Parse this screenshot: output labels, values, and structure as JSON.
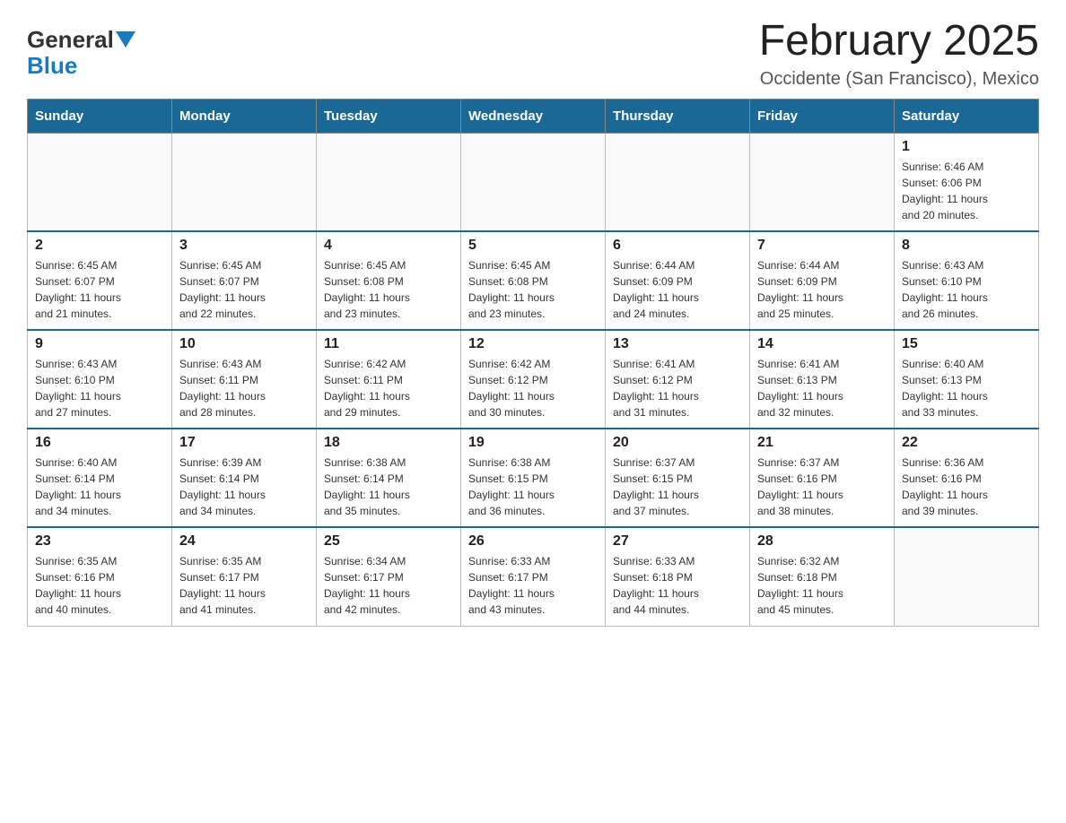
{
  "header": {
    "logo": {
      "general": "General",
      "blue": "Blue"
    },
    "title": "February 2025",
    "location": "Occidente (San Francisco), Mexico"
  },
  "days_of_week": [
    "Sunday",
    "Monday",
    "Tuesday",
    "Wednesday",
    "Thursday",
    "Friday",
    "Saturday"
  ],
  "weeks": [
    {
      "days": [
        {
          "number": "",
          "info": ""
        },
        {
          "number": "",
          "info": ""
        },
        {
          "number": "",
          "info": ""
        },
        {
          "number": "",
          "info": ""
        },
        {
          "number": "",
          "info": ""
        },
        {
          "number": "",
          "info": ""
        },
        {
          "number": "1",
          "info": "Sunrise: 6:46 AM\nSunset: 6:06 PM\nDaylight: 11 hours\nand 20 minutes."
        }
      ]
    },
    {
      "days": [
        {
          "number": "2",
          "info": "Sunrise: 6:45 AM\nSunset: 6:07 PM\nDaylight: 11 hours\nand 21 minutes."
        },
        {
          "number": "3",
          "info": "Sunrise: 6:45 AM\nSunset: 6:07 PM\nDaylight: 11 hours\nand 22 minutes."
        },
        {
          "number": "4",
          "info": "Sunrise: 6:45 AM\nSunset: 6:08 PM\nDaylight: 11 hours\nand 23 minutes."
        },
        {
          "number": "5",
          "info": "Sunrise: 6:45 AM\nSunset: 6:08 PM\nDaylight: 11 hours\nand 23 minutes."
        },
        {
          "number": "6",
          "info": "Sunrise: 6:44 AM\nSunset: 6:09 PM\nDaylight: 11 hours\nand 24 minutes."
        },
        {
          "number": "7",
          "info": "Sunrise: 6:44 AM\nSunset: 6:09 PM\nDaylight: 11 hours\nand 25 minutes."
        },
        {
          "number": "8",
          "info": "Sunrise: 6:43 AM\nSunset: 6:10 PM\nDaylight: 11 hours\nand 26 minutes."
        }
      ]
    },
    {
      "days": [
        {
          "number": "9",
          "info": "Sunrise: 6:43 AM\nSunset: 6:10 PM\nDaylight: 11 hours\nand 27 minutes."
        },
        {
          "number": "10",
          "info": "Sunrise: 6:43 AM\nSunset: 6:11 PM\nDaylight: 11 hours\nand 28 minutes."
        },
        {
          "number": "11",
          "info": "Sunrise: 6:42 AM\nSunset: 6:11 PM\nDaylight: 11 hours\nand 29 minutes."
        },
        {
          "number": "12",
          "info": "Sunrise: 6:42 AM\nSunset: 6:12 PM\nDaylight: 11 hours\nand 30 minutes."
        },
        {
          "number": "13",
          "info": "Sunrise: 6:41 AM\nSunset: 6:12 PM\nDaylight: 11 hours\nand 31 minutes."
        },
        {
          "number": "14",
          "info": "Sunrise: 6:41 AM\nSunset: 6:13 PM\nDaylight: 11 hours\nand 32 minutes."
        },
        {
          "number": "15",
          "info": "Sunrise: 6:40 AM\nSunset: 6:13 PM\nDaylight: 11 hours\nand 33 minutes."
        }
      ]
    },
    {
      "days": [
        {
          "number": "16",
          "info": "Sunrise: 6:40 AM\nSunset: 6:14 PM\nDaylight: 11 hours\nand 34 minutes."
        },
        {
          "number": "17",
          "info": "Sunrise: 6:39 AM\nSunset: 6:14 PM\nDaylight: 11 hours\nand 34 minutes."
        },
        {
          "number": "18",
          "info": "Sunrise: 6:38 AM\nSunset: 6:14 PM\nDaylight: 11 hours\nand 35 minutes."
        },
        {
          "number": "19",
          "info": "Sunrise: 6:38 AM\nSunset: 6:15 PM\nDaylight: 11 hours\nand 36 minutes."
        },
        {
          "number": "20",
          "info": "Sunrise: 6:37 AM\nSunset: 6:15 PM\nDaylight: 11 hours\nand 37 minutes."
        },
        {
          "number": "21",
          "info": "Sunrise: 6:37 AM\nSunset: 6:16 PM\nDaylight: 11 hours\nand 38 minutes."
        },
        {
          "number": "22",
          "info": "Sunrise: 6:36 AM\nSunset: 6:16 PM\nDaylight: 11 hours\nand 39 minutes."
        }
      ]
    },
    {
      "days": [
        {
          "number": "23",
          "info": "Sunrise: 6:35 AM\nSunset: 6:16 PM\nDaylight: 11 hours\nand 40 minutes."
        },
        {
          "number": "24",
          "info": "Sunrise: 6:35 AM\nSunset: 6:17 PM\nDaylight: 11 hours\nand 41 minutes."
        },
        {
          "number": "25",
          "info": "Sunrise: 6:34 AM\nSunset: 6:17 PM\nDaylight: 11 hours\nand 42 minutes."
        },
        {
          "number": "26",
          "info": "Sunrise: 6:33 AM\nSunset: 6:17 PM\nDaylight: 11 hours\nand 43 minutes."
        },
        {
          "number": "27",
          "info": "Sunrise: 6:33 AM\nSunset: 6:18 PM\nDaylight: 11 hours\nand 44 minutes."
        },
        {
          "number": "28",
          "info": "Sunrise: 6:32 AM\nSunset: 6:18 PM\nDaylight: 11 hours\nand 45 minutes."
        },
        {
          "number": "",
          "info": ""
        }
      ]
    }
  ]
}
